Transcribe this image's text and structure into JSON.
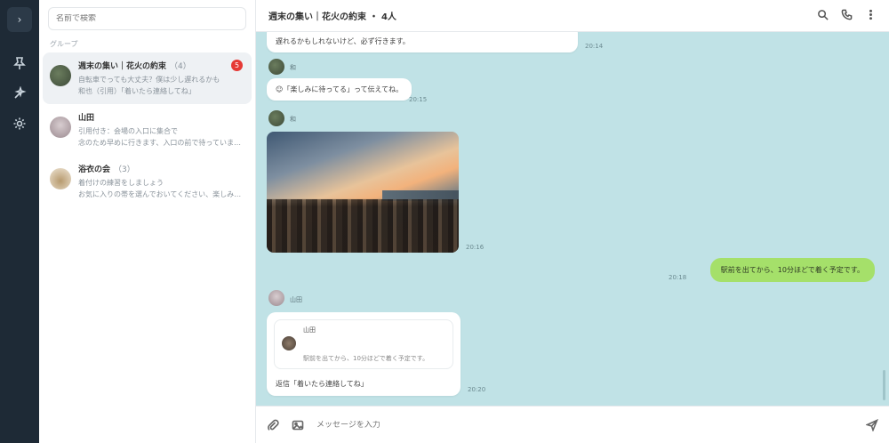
{
  "rail": {
    "top_label": "›",
    "icons": [
      "pin-icon",
      "sparkle-icon",
      "settings-icon"
    ]
  },
  "sidebar": {
    "search_placeholder": "名前で検索",
    "section_label": "グループ",
    "chats": [
      {
        "name": "週末の集い｜花火の約束",
        "count": "（4）",
        "line1": "自転車でっても大丈夫？僕は少し遅れるかも",
        "line2": "和也（引用）「着いたら連絡してね」",
        "unread": "5"
      },
      {
        "name": "山田",
        "count": "",
        "line1": "引用付き：会場の入口に集合で",
        "line2": "念のため早めに行きます、入口の前で待っていますね。",
        "unread": ""
      },
      {
        "name": "浴衣の会",
        "count": "（3）",
        "line1": "着付けの練習をしましょう",
        "line2": "お気に入りの帯を選んでおいてください、楽しみにしています",
        "unread": ""
      }
    ]
  },
  "header": {
    "title": "週末の集い｜花火の約束 ・ 4人",
    "actions": [
      "search-icon",
      "phone-icon",
      "more-icon"
    ]
  },
  "messages": {
    "m0_text": "遅れるかもしれないけど、必ず行きます。",
    "m0_time": "20:14",
    "m1_sender": "和",
    "m1_text": "☺「楽しみに待ってる」って伝えてね。",
    "m1_time": "20:15",
    "m2_sender": "和",
    "m2_time": "20:16",
    "m3_text": "駅前を出てから、10分ほどで着く予定です。",
    "m3_time": "20:18",
    "m4_sender": "山田",
    "m4_quote_name": "山田",
    "m4_quote_text": "駅前を出てから、10分ほどで着く予定です。",
    "m4_reply": "返信「着いたら連絡してね」",
    "m4_time": "20:20"
  },
  "composer": {
    "placeholder": "メッセージを入力",
    "tools": [
      "attach-icon",
      "image-icon"
    ],
    "send": "send-icon"
  }
}
